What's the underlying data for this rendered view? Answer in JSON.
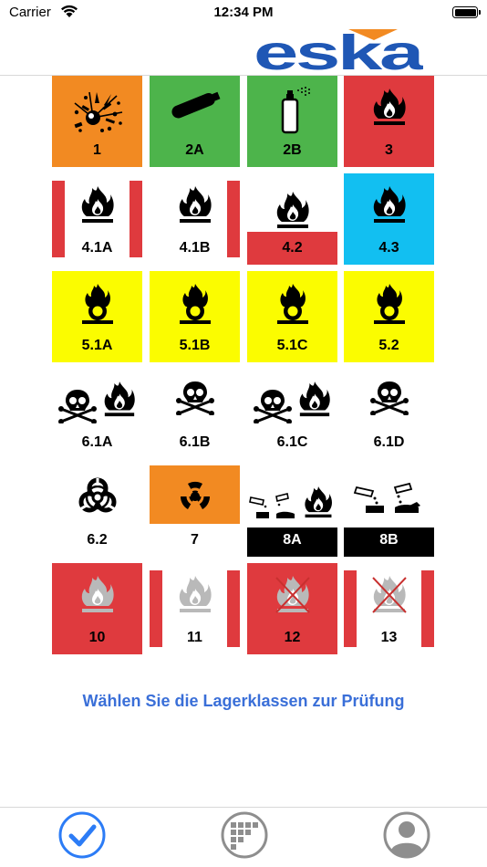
{
  "status_bar": {
    "carrier": "Carrier",
    "time": "12:34 PM"
  },
  "brand": {
    "logo_text": "eska",
    "blue": "#1f57b5",
    "orange": "#f28a22"
  },
  "classes": [
    {
      "id": "1",
      "label": "1",
      "icon": "explosive-icon",
      "style": "full-orange"
    },
    {
      "id": "2A",
      "label": "2A",
      "icon": "gas-cylinder-icon",
      "style": "full-green"
    },
    {
      "id": "2B",
      "label": "2B",
      "icon": "aerosol-can-icon",
      "style": "full-green"
    },
    {
      "id": "3",
      "label": "3",
      "icon": "flame-icon",
      "style": "full-red"
    },
    {
      "id": "4.1A",
      "label": "4.1A",
      "icon": "flame-icon",
      "style": "red-side-stripes"
    },
    {
      "id": "4.1B",
      "label": "4.1B",
      "icon": "flame-icon",
      "style": "red-right-stripe"
    },
    {
      "id": "4.2",
      "label": "4.2",
      "icon": "flame-icon",
      "style": "red-bottom-band"
    },
    {
      "id": "4.3",
      "label": "4.3",
      "icon": "flame-icon",
      "style": "full-blue"
    },
    {
      "id": "5.1A",
      "label": "5.1A",
      "icon": "oxidizer-icon",
      "style": "full-yellow"
    },
    {
      "id": "5.1B",
      "label": "5.1B",
      "icon": "oxidizer-icon",
      "style": "full-yellow"
    },
    {
      "id": "5.1C",
      "label": "5.1C",
      "icon": "oxidizer-icon",
      "style": "full-yellow"
    },
    {
      "id": "5.2",
      "label": "5.2",
      "icon": "oxidizer-icon",
      "style": "full-yellow"
    },
    {
      "id": "6.1A",
      "label": "6.1A",
      "icon": "skull-flame-icon",
      "style": "white"
    },
    {
      "id": "6.1B",
      "label": "6.1B",
      "icon": "skull-icon",
      "style": "white"
    },
    {
      "id": "6.1C",
      "label": "6.1C",
      "icon": "skull-flame-icon",
      "style": "white"
    },
    {
      "id": "6.1D",
      "label": "6.1D",
      "icon": "skull-icon",
      "style": "white"
    },
    {
      "id": "6.2",
      "label": "6.2",
      "icon": "biohazard-icon",
      "style": "white"
    },
    {
      "id": "7",
      "label": "7",
      "icon": "radiation-icon",
      "style": "orange-top"
    },
    {
      "id": "8A",
      "label": "8A",
      "icon": "corrosive-flame-icon",
      "style": "black-bottom-band"
    },
    {
      "id": "8B",
      "label": "8B",
      "icon": "corrosive-icon",
      "style": "black-bottom-band"
    },
    {
      "id": "10",
      "label": "10",
      "icon": "gray-flame-icon",
      "style": "full-red"
    },
    {
      "id": "11",
      "label": "11",
      "icon": "gray-flame-icon",
      "style": "red-side-stripes"
    },
    {
      "id": "12",
      "label": "12",
      "icon": "crossed-flame-icon",
      "style": "full-red"
    },
    {
      "id": "13",
      "label": "13",
      "icon": "crossed-flame-icon",
      "style": "red-side-stripes"
    }
  ],
  "prompt": "Wählen Sie die Lagerklassen zur Prüfung",
  "tabs": [
    {
      "name": "check",
      "icon": "checkmark-icon",
      "selected": true
    },
    {
      "name": "list",
      "icon": "grid-icon",
      "selected": false
    },
    {
      "name": "profile",
      "icon": "person-icon",
      "selected": false
    }
  ],
  "colors": {
    "accent": "#3a6fd8",
    "red": "#df3a3e",
    "green": "#4db44b",
    "yellow": "#fbfc00",
    "blue": "#12bff1"
  }
}
